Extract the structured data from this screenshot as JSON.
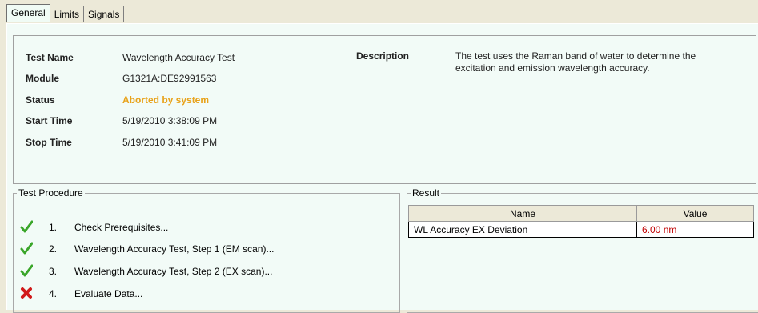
{
  "tabs": [
    {
      "label": "General",
      "active": true
    },
    {
      "label": "Limits"
    },
    {
      "label": "Signals"
    }
  ],
  "info": {
    "test_name_label": "Test Name",
    "test_name_value": "Wavelength Accuracy Test",
    "module_label": "Module",
    "module_value": "G1321A:DE92991563",
    "status_label": "Status",
    "status_value": "Aborted by system",
    "start_label": "Start Time",
    "start_value": "5/19/2010 3:38:09 PM",
    "stop_label": "Stop Time",
    "stop_value": "5/19/2010 3:41:09 PM",
    "description_label": "Description",
    "description_line1": "The test uses the Raman band of water to determine the",
    "description_line2": "excitation and emission wavelength accuracy."
  },
  "procedure": {
    "title": "Test Procedure",
    "steps": [
      {
        "num": "1.",
        "text": "Check Prerequisites...",
        "icon": "check-icon"
      },
      {
        "num": "2.",
        "text": "Wavelength Accuracy Test, Step 1 (EM scan)...",
        "icon": "check-icon"
      },
      {
        "num": "3.",
        "text": "Wavelength Accuracy Test, Step 2 (EX scan)...",
        "icon": "check-icon"
      },
      {
        "num": "4.",
        "text": "Evaluate Data...",
        "icon": "x-icon"
      }
    ]
  },
  "result": {
    "title": "Result",
    "headers": [
      "Name",
      "Value"
    ],
    "rows": [
      {
        "name": "WL Accuracy EX Deviation",
        "value": "6.00 nm"
      }
    ]
  },
  "colors": {
    "status": "#e8a21a",
    "result_value": "#c00000",
    "check": "#3aa62a",
    "fail": "#d11a1a"
  }
}
